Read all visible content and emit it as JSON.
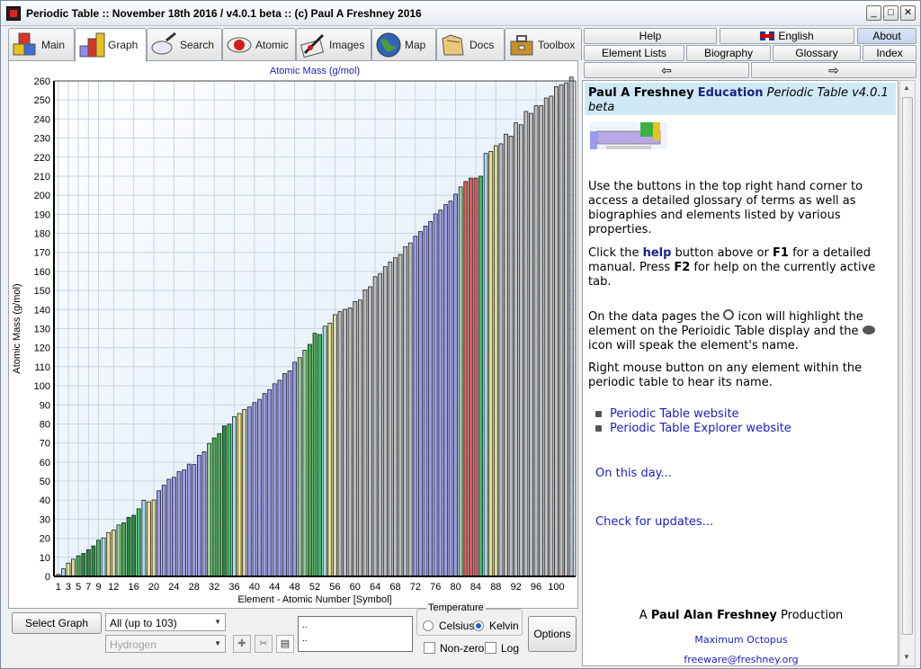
{
  "window": {
    "title": "Periodic Table :: November 18th 2016 / v4.0.1 beta :: (c) Paul A Freshney 2016",
    "minimize": "_",
    "maximize": "□",
    "close": "✕"
  },
  "left_tabs": [
    {
      "label": "Main",
      "icon": "cubes-icon"
    },
    {
      "label": "Graph",
      "icon": "graph-blocks-icon"
    },
    {
      "label": "Search",
      "icon": "magnifier-icon"
    },
    {
      "label": "Atomic",
      "icon": "atom-icon"
    },
    {
      "label": "Images",
      "icon": "pen-image-icon"
    },
    {
      "label": "Map",
      "icon": "globe-icon"
    },
    {
      "label": "Docs",
      "icon": "folders-icon"
    },
    {
      "label": "Toolbox",
      "icon": "toolbox-icon"
    }
  ],
  "active_left_tab": "Graph",
  "right_tabs": {
    "row1": [
      "Help",
      "English",
      "About"
    ],
    "row2": [
      "Element Lists",
      "Biography",
      "Glossary",
      "Index"
    ],
    "back": "⇦",
    "forward": "⇨",
    "active": "About"
  },
  "chart_data": {
    "type": "bar",
    "title": "Atomic Mass (g/mol)",
    "xlabel": "Element - Atomic Number [Symbol]",
    "ylabel": "Atomic Mass (g/mol)",
    "ylim": [
      0,
      260
    ],
    "yticks": [
      0,
      10,
      20,
      30,
      40,
      50,
      60,
      70,
      80,
      90,
      100,
      110,
      120,
      130,
      140,
      150,
      160,
      170,
      180,
      190,
      200,
      210,
      220,
      230,
      240,
      250,
      260
    ],
    "xtick_labels": [
      "1",
      "3",
      "5",
      "7",
      "9",
      "12",
      "16",
      "20",
      "24",
      "28",
      "32",
      "36",
      "40",
      "44",
      "48",
      "52",
      "56",
      "60",
      "64",
      "68",
      "72",
      "76",
      "80",
      "84",
      "88",
      "92",
      "96",
      "100"
    ],
    "xtick_positions": [
      1,
      3,
      5,
      7,
      9,
      12,
      16,
      20,
      24,
      28,
      32,
      36,
      40,
      44,
      48,
      52,
      56,
      60,
      64,
      68,
      72,
      76,
      80,
      84,
      88,
      92,
      96,
      100
    ],
    "atomic_numbers_range": [
      1,
      103
    ],
    "values": [
      1.008,
      4.003,
      6.94,
      9.012,
      10.81,
      12.011,
      14.007,
      15.999,
      18.998,
      20.18,
      22.99,
      24.305,
      26.982,
      28.085,
      30.974,
      32.06,
      35.45,
      39.948,
      39.098,
      40.078,
      44.956,
      47.867,
      50.942,
      51.996,
      54.938,
      55.845,
      58.933,
      58.693,
      63.546,
      65.38,
      69.723,
      72.63,
      74.922,
      78.971,
      79.904,
      83.798,
      85.468,
      87.62,
      88.906,
      91.224,
      92.906,
      95.95,
      98,
      101.07,
      102.91,
      106.42,
      107.87,
      112.41,
      114.82,
      118.71,
      121.76,
      127.6,
      126.9,
      131.29,
      132.91,
      137.33,
      138.91,
      140.12,
      140.91,
      144.24,
      145,
      150.36,
      151.96,
      157.25,
      158.93,
      162.5,
      164.93,
      167.26,
      168.93,
      173.05,
      174.97,
      178.49,
      180.95,
      183.84,
      186.21,
      190.23,
      192.22,
      195.08,
      196.97,
      200.59,
      204.38,
      207.2,
      208.98,
      209,
      210,
      222,
      223,
      226,
      227,
      232.04,
      231.04,
      238.03,
      237,
      244,
      243,
      247,
      247,
      251,
      252,
      257,
      258,
      259,
      262
    ],
    "group_colors": {
      "hydrogen": "#f4a6a6",
      "noble_gas": "#a8d8ef",
      "alkali": "#f0e27a",
      "alkaline_earth": "#d9d9a2",
      "metalloid": "#3cb043",
      "nonmetal": "#1f8f3a",
      "halogen": "#2ec25c",
      "transition": "#9a9aee",
      "post_transition": "#8fd18f",
      "lanthanide": "#bdbdbd",
      "actinide": "#c0c0c0",
      "polonium": "#e05a5a"
    },
    "grid": true
  },
  "controls": {
    "select_graph_label": "Select Graph",
    "range_combo": "All (up to 103)",
    "element_combo": "Hydrogen",
    "memo_line1": "..",
    "memo_line2": "..",
    "temperature_caption": "Temperature",
    "celsius": "Celsius",
    "kelvin": "Kelvin",
    "non_zero": "Non-zero",
    "log": "Log",
    "options": "Options"
  },
  "info": {
    "header_name": "Paul A Freshney",
    "header_edu": "Education",
    "header_title": "Periodic Table v4.0.1 beta",
    "para1": "Use the buttons in the top right hand corner to access a detailed glossary of terms as well as biographies and elements listed by various properties.",
    "para2_a": "Click the ",
    "para2_help": "help",
    "para2_b": " button above or ",
    "para2_f1": "F1",
    "para2_c": " for a detailed manual. Press ",
    "para2_f2": "F2",
    "para2_d": " for help on the currently active tab.",
    "para3_a": "On the data pages the ",
    "para3_b": " icon will highlight the element on the Perioidic Table display and the ",
    "para3_c": " icon will speak the element's name.",
    "para4": "Right mouse button on any element within the periodic table to hear its name.",
    "link1": "Periodic Table website",
    "link2": "Periodic Table Explorer website",
    "on_this_day": "On this day...",
    "check_updates": "Check for updates...",
    "production_a": "A ",
    "production_name": "Paul Alan Freshney",
    "production_b": " Production",
    "company": "Maximum Octopus",
    "email": "freeware@freshney.org"
  }
}
